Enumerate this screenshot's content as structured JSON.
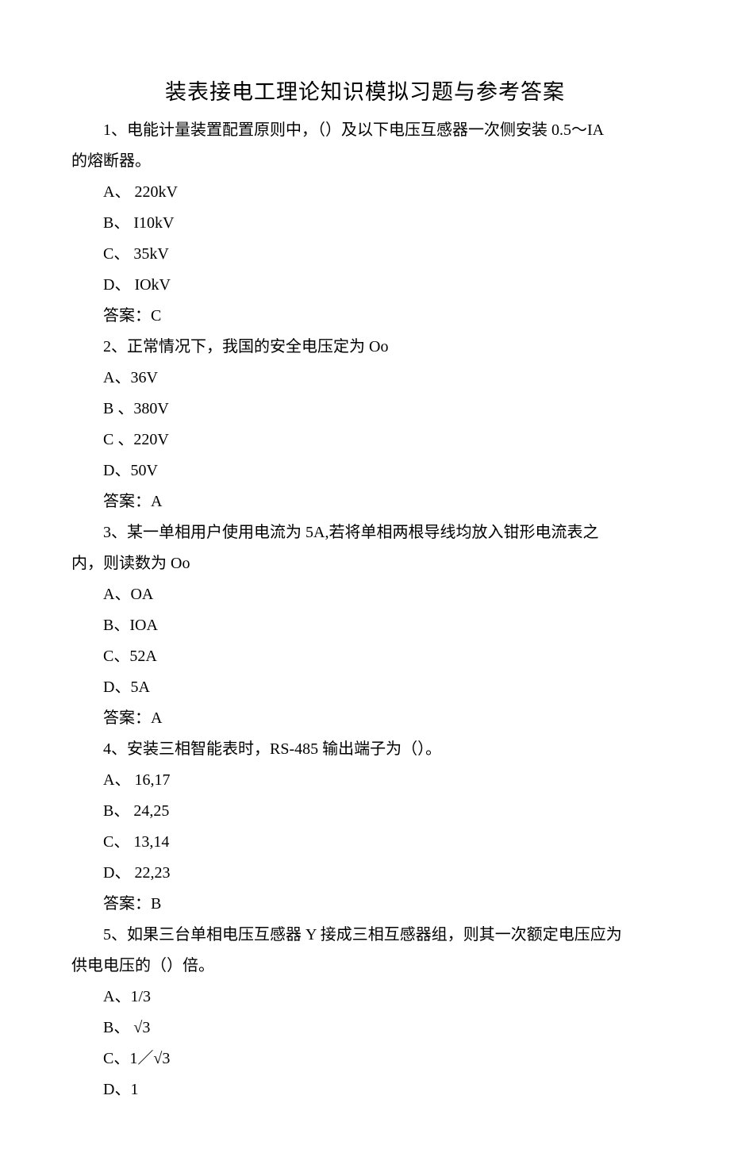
{
  "title": "装表接电工理论知识模拟习题与参考答案",
  "questions": [
    {
      "stem_lines": [
        "1、电能计量装置配置原则中，（）及以下电压互感器一次侧安装 0.5～IA",
        "的熔断器。"
      ],
      "options": [
        "A、 220kV",
        "B、 I10kV",
        "C、 35kV",
        "D、 IOkV"
      ],
      "answer": "答案：C"
    },
    {
      "stem_lines": [
        "2、正常情况下，我国的安全电压定为 Oo"
      ],
      "options": [
        "A、36V",
        "B 、380V",
        "C 、220V",
        "D、50V"
      ],
      "answer": "答案：A"
    },
    {
      "stem_lines": [
        "3、某一单相用户使用电流为 5A,若将单相两根导线均放入钳形电流表之",
        "内，则读数为 Oo"
      ],
      "options": [
        "A、OA",
        "B、IOA",
        "C、52A",
        "D、5A"
      ],
      "answer": "答案：A"
    },
    {
      "stem_lines": [
        "4、安装三相智能表时，RS-485 输出端子为（）。"
      ],
      "options": [
        "A、 16,17",
        "B、 24,25",
        "C、 13,14",
        "D、 22,23"
      ],
      "answer": "答案：B"
    },
    {
      "stem_lines": [
        "5、如果三台单相电压互感器 Y 接成三相互感器组，则其一次额定电压应为",
        "供电电压的（）倍。"
      ],
      "options": [
        "A、1/3",
        "B、 √3",
        "C、1／√3",
        "D、1"
      ],
      "answer": ""
    }
  ]
}
